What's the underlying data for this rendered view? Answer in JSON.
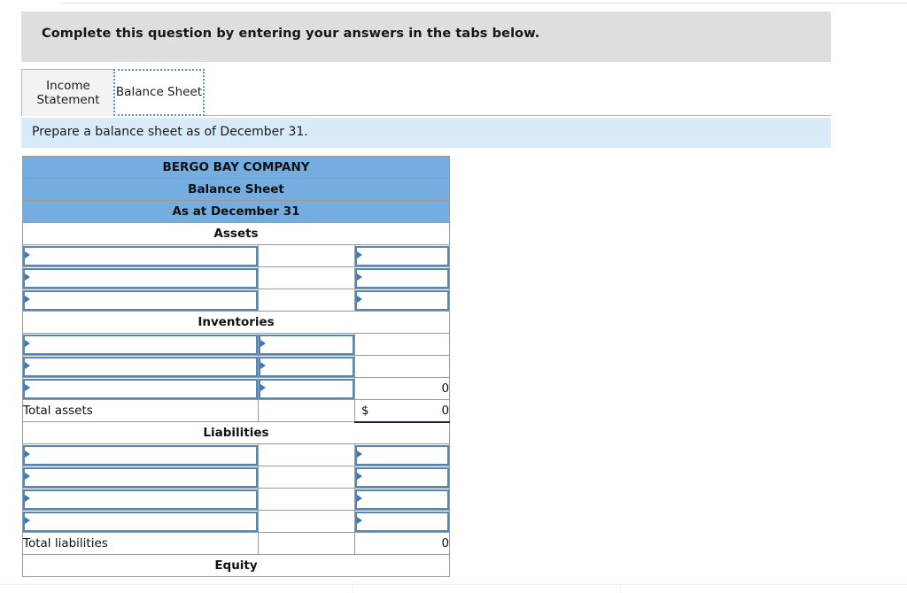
{
  "header": {
    "instruction": "Complete this question by entering your answers in the tabs below."
  },
  "tabs": [
    {
      "label": "Income Statement",
      "active": false,
      "name": "tab-income-statement"
    },
    {
      "label": "Balance Sheet",
      "active": true,
      "name": "tab-balance-sheet"
    }
  ],
  "prompt": {
    "text": "Prepare a balance sheet as of December 31."
  },
  "colors": {
    "header_blue": "#76ade1",
    "prompt_blue": "#d9eaf8",
    "gray_bar": "#dedede",
    "input_border": "#5287b8",
    "flag_marker": "#2f6fad"
  },
  "balance_sheet": {
    "title_rows": [
      "BERGO BAY COMPANY",
      "Balance Sheet",
      "As at December 31"
    ],
    "sections": [
      {
        "heading": "Assets",
        "rows": [
          {
            "type": "input",
            "col1": "",
            "col2": "",
            "col3": "",
            "col1_input": true,
            "col2_input": false,
            "col3_input": true
          },
          {
            "type": "input",
            "col1": "",
            "col2": "",
            "col3": "",
            "col1_input": true,
            "col2_input": false,
            "col3_input": true
          },
          {
            "type": "input",
            "col1": "",
            "col2": "",
            "col3": "",
            "col1_input": true,
            "col2_input": false,
            "col3_input": true
          }
        ]
      },
      {
        "heading": "Inventories",
        "rows": [
          {
            "type": "input",
            "col1": "",
            "col2": "",
            "col3": "",
            "col1_input": true,
            "col2_input": true,
            "col3_input": false
          },
          {
            "type": "input",
            "col1": "",
            "col2": "",
            "col3": "",
            "col1_input": true,
            "col2_input": true,
            "col3_input": false
          },
          {
            "type": "input",
            "col1": "",
            "col2": "",
            "col3": "0",
            "col1_input": true,
            "col2_input": true,
            "col3_input": false
          }
        ],
        "total": {
          "label": "Total assets",
          "col2": "",
          "currency": "$",
          "value": "0"
        }
      },
      {
        "heading": "Liabilities",
        "rows": [
          {
            "type": "input",
            "col1": "",
            "col2": "",
            "col3": "",
            "col1_input": true,
            "col2_input": false,
            "col3_input": true
          },
          {
            "type": "input",
            "col1": "",
            "col2": "",
            "col3": "",
            "col1_input": true,
            "col2_input": false,
            "col3_input": true
          },
          {
            "type": "input",
            "col1": "",
            "col2": "",
            "col3": "",
            "col1_input": true,
            "col2_input": false,
            "col3_input": true
          },
          {
            "type": "input",
            "col1": "",
            "col2": "",
            "col3": "",
            "col1_input": true,
            "col2_input": false,
            "col3_input": true
          }
        ],
        "total": {
          "label": "Total liabilities",
          "col2": "",
          "currency": "",
          "value": "0"
        }
      },
      {
        "heading": "Equity",
        "rows": [],
        "total": null
      }
    ]
  }
}
